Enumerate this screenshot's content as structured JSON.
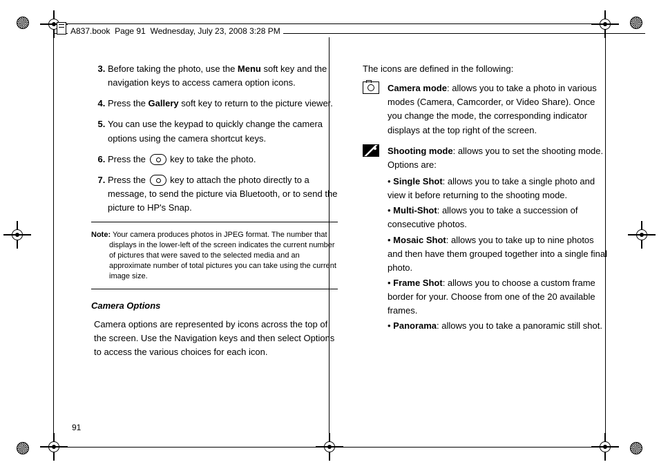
{
  "header": {
    "book_file": "A837.book",
    "page_info": "Page 91",
    "date_info": "Wednesday, July 23, 2008  3:28 PM"
  },
  "left": {
    "steps_start": 3,
    "steps": [
      {
        "pre": "Before taking the photo, use the ",
        "b": "Menu",
        "post": " soft key and the navigation keys to access camera option icons."
      },
      {
        "pre": "Press the ",
        "b": "Gallery",
        "post": " soft key to return to the picture viewer."
      },
      {
        "pre": "You can use the keypad to quickly change the camera options using the camera shortcut keys.",
        "b": "",
        "post": ""
      },
      {
        "pre": "Press the ",
        "key": true,
        "post": " key to take the photo."
      },
      {
        "pre": "Press the ",
        "key": true,
        "post": " key to attach the photo directly to a message, to send the picture via Bluetooth, or to send the picture to HP's Snap."
      }
    ],
    "note_label": "Note:",
    "note_body": "Your camera produces photos in JPEG format. The number that displays in the lower-left of the screen indicates the current number of pictures that were saved to the selected media and an approximate number of total pictures you can take using the current image size.",
    "section_title": "Camera Options",
    "section_body": "Camera options are represented by icons across the top of the screen. Use the Navigation keys and then select Options to access the various choices for each icon."
  },
  "right": {
    "intro": "The icons are defined in the following:",
    "defs": [
      {
        "icon": "camera",
        "title": "Camera mode",
        "body": ": allows you to take a photo in various modes (Camera, Camcorder, or Video Share). Once you change the mode, the corresponding indicator displays at the top right of the screen.",
        "subs": []
      },
      {
        "icon": "landscape",
        "title": "Shooting mode",
        "body": ": allows you to set the shooting mode. Options are:",
        "subs": [
          {
            "b": "Single Shot",
            "t": ": allows you to take a single photo and view it before returning to the shooting mode."
          },
          {
            "b": "Multi-Shot",
            "t": ": allows you to take a succession of consecutive photos."
          },
          {
            "b": "Mosaic Shot",
            "t": ": allows you to take up to nine photos and then have them grouped together into a single final photo."
          },
          {
            "b": "Frame Shot",
            "t": ": allows you to choose a custom frame border for your. Choose from one of the 20 available frames."
          },
          {
            "b": "Panorama",
            "t": ": allows you to take a panoramic still shot."
          }
        ]
      }
    ]
  },
  "page_number": "91"
}
